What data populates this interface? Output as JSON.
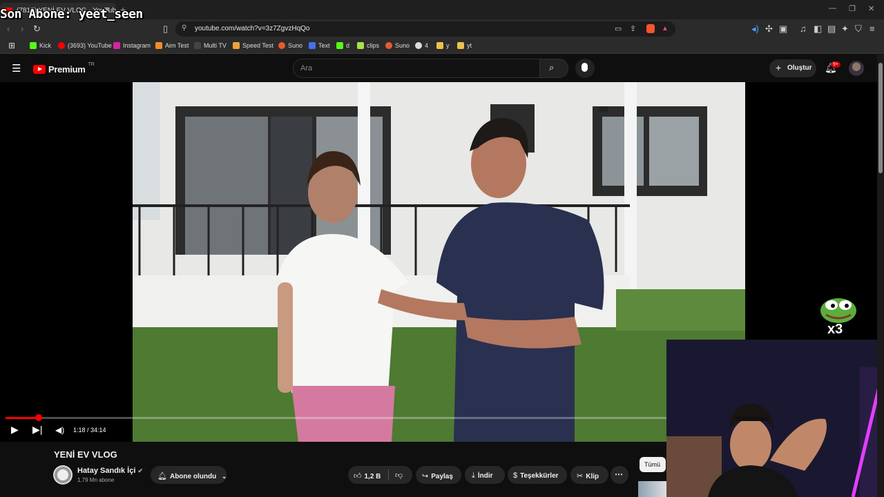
{
  "overlay": {
    "last_subscriber": "Son Abone: yeet_seen"
  },
  "browser": {
    "tab_title": "(7818) YENİ EV VLOG - YouTube",
    "url": "youtube.com/watch?v=3z7ZgvzHqQo",
    "bookmarks": [
      "Kick",
      "(3693) YouTube",
      "Instagram",
      "Aim Test",
      "Multi TV",
      "Speed Test",
      "Suno",
      "Text",
      "d",
      "clips",
      "Suno",
      "4",
      "y",
      "yt"
    ]
  },
  "youtube": {
    "logo_text": "Premium",
    "region": "TR",
    "search_placeholder": "Ara",
    "create_label": "Oluştur",
    "notifications_badge": "9+"
  },
  "player": {
    "time_current": "1:18",
    "time_total": "34:14",
    "time_display": "1:18 / 34:14",
    "progress_fraction": 0.045
  },
  "video": {
    "title": "YENİ EV VLOG",
    "channel": "Hatay Sandık İçi",
    "subscribers": "1,79 Mn abone",
    "subscribed_label": "Abone olundu",
    "likes": "1,2 B",
    "share_label": "Paylaş",
    "download_label": "İndir",
    "thanks_label": "Teşekkürler",
    "clip_label": "Klip",
    "chip_all": "Tümü"
  },
  "stream": {
    "emote_multiplier": "x3"
  },
  "colors": {
    "accent": "#ff0000",
    "background": "#0f0f0f",
    "pill": "#272727"
  }
}
